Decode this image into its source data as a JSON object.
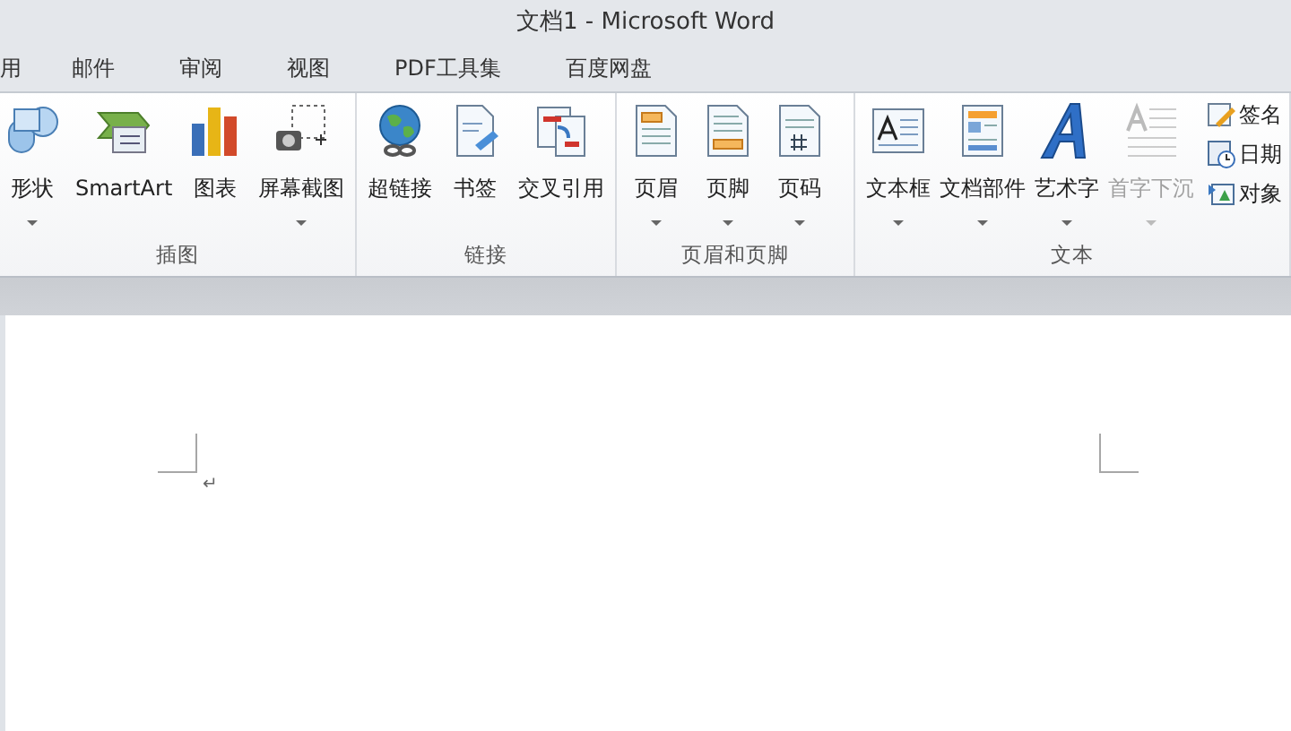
{
  "window": {
    "title": "文档1 - Microsoft Word"
  },
  "tabs": [
    {
      "label": "用",
      "selected": false
    },
    {
      "label": "邮件",
      "selected": false
    },
    {
      "label": "审阅",
      "selected": false
    },
    {
      "label": "视图",
      "selected": false
    },
    {
      "label": "PDF工具集",
      "selected": false
    },
    {
      "label": "百度网盘",
      "selected": false
    }
  ],
  "ribbon_groups": [
    {
      "label": "插图",
      "buttons": [
        {
          "label": "形状",
          "dropdown": true,
          "disabled": false
        },
        {
          "label": "SmartArt",
          "dropdown": false,
          "disabled": false
        },
        {
          "label": "图表",
          "dropdown": false,
          "disabled": false
        },
        {
          "label": "屏幕截图",
          "dropdown": true,
          "disabled": false
        }
      ]
    },
    {
      "label": "链接",
      "buttons": [
        {
          "label": "超链接",
          "dropdown": false,
          "disabled": false
        },
        {
          "label": "书签",
          "dropdown": false,
          "disabled": false
        },
        {
          "label": "交叉引用",
          "dropdown": false,
          "disabled": false
        }
      ]
    },
    {
      "label": "页眉和页脚",
      "buttons": [
        {
          "label": "页眉",
          "dropdown": true,
          "disabled": false
        },
        {
          "label": "页脚",
          "dropdown": true,
          "disabled": false
        },
        {
          "label": "页码",
          "dropdown": true,
          "disabled": false
        }
      ]
    },
    {
      "label": "文本",
      "buttons": [
        {
          "label": "文本框",
          "dropdown": true,
          "disabled": false
        },
        {
          "label": "文档部件",
          "dropdown": true,
          "disabled": false
        },
        {
          "label": "艺术字",
          "dropdown": true,
          "disabled": false
        },
        {
          "label": "首字下沉",
          "dropdown": true,
          "disabled": true
        }
      ],
      "small_buttons": [
        {
          "label": "签名"
        },
        {
          "label": "日期"
        },
        {
          "label": "对象"
        }
      ]
    }
  ],
  "document": {
    "paragraph_mark": "↵"
  }
}
